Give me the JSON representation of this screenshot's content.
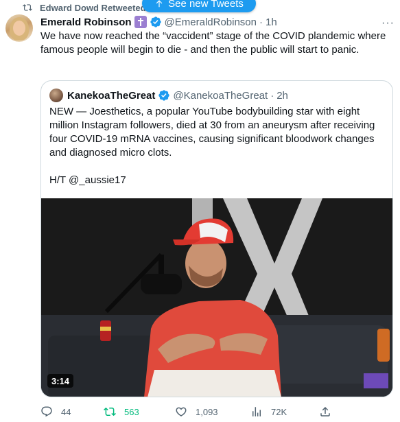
{
  "social_context": {
    "icon": "retweet-icon",
    "text": "Edward Dowd Retweeted"
  },
  "new_tweets_pill": {
    "icon": "arrow-up-icon",
    "label": "See new Tweets",
    "color": "#1d9bf0"
  },
  "tweet": {
    "author_name": "Emerald Robinson",
    "author_badges": [
      "cross-icon",
      "verified-badge-icon"
    ],
    "author_handle": "@EmeraldRobinson",
    "separator": "·",
    "time": "1h",
    "more_icon": "more-dots-icon",
    "text": "We have now reached the “vaccident” stage of the COVID plandemic where famous people will begin to die - and then the public will start to panic.",
    "quoted": {
      "author_name": "KanekoaTheGreat",
      "author_handle": "@KanekoaTheGreat",
      "separator": "·",
      "time": "2h",
      "text": "NEW — Joesthetics, a popular YouTube bodybuilding star with eight million Instagram followers, died at 30 from an aneurysm after receiving four COVID-19 mRNA vaccines, causing significant bloodwork changes and diagnosed micro clots.\n\nH/T @_aussie17",
      "media": {
        "type": "video",
        "duration": "3:14",
        "description_icon": "video-thumbnail"
      }
    },
    "actions": {
      "reply": {
        "icon": "reply-icon",
        "count": "44"
      },
      "retweet": {
        "icon": "retweet-icon",
        "count": "563",
        "active": true,
        "color": "#00ba7c"
      },
      "like": {
        "icon": "heart-icon",
        "count": "1,093"
      },
      "views": {
        "icon": "views-icon",
        "count": "72K"
      },
      "share": {
        "icon": "share-icon"
      }
    }
  }
}
